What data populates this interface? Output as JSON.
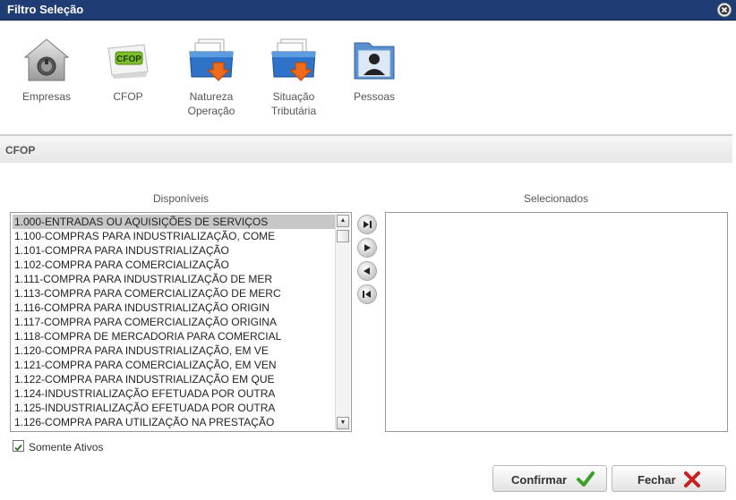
{
  "window": {
    "title": "Filtro Seleção"
  },
  "toolbar": {
    "items": [
      {
        "label": "Empresas",
        "icon": "lock-building-icon"
      },
      {
        "label": "CFOP",
        "icon": "cfop-icon"
      },
      {
        "label": "Natureza\nOperação",
        "icon": "folder-download-icon"
      },
      {
        "label": "Situação\nTributária",
        "icon": "folder-download-icon"
      },
      {
        "label": "Pessoas",
        "icon": "person-folder-icon"
      }
    ]
  },
  "section": {
    "title": "CFOP"
  },
  "available": {
    "header": "Disponíveis",
    "items": [
      "1.000-ENTRADAS OU AQUISIÇÕES DE SERVIÇOS",
      "1.100-COMPRAS PARA INDUSTRIALIZAÇÃO, COME",
      "1.101-COMPRA PARA INDUSTRIALIZAÇÃO",
      "1.102-COMPRA PARA COMERCIALIZAÇÃO",
      "1.111-COMPRA PARA INDUSTRIALIZAÇÃO DE MER",
      "1.113-COMPRA PARA COMERCIALIZAÇÃO DE MERC",
      "1.116-COMPRA PARA INDUSTRIALIZAÇÃO ORIGIN",
      "1.117-COMPRA PARA COMERCIALIZAÇÃO ORIGINA",
      "1.118-COMPRA DE MERCADORIA PARA COMERCIAL",
      "1.120-COMPRA PARA INDUSTRIALIZAÇÃO, EM VE",
      "1.121-COMPRA PARA COMERCIALIZAÇÃO, EM VEN",
      "1.122-COMPRA PARA INDUSTRIALIZAÇÃO EM QUE",
      "1.124-INDUSTRIALIZAÇÃO EFETUADA POR OUTRA",
      "1.125-INDUSTRIALIZAÇÃO EFETUADA POR OUTRA",
      "1.126-COMPRA PARA UTILIZAÇÃO NA PRESTAÇÃO"
    ]
  },
  "selected": {
    "header": "Selecionados",
    "items": []
  },
  "filter": {
    "label": "Somente Ativos",
    "checked": true
  },
  "buttons": {
    "confirm": "Confirmar",
    "close": "Fechar"
  },
  "colors": {
    "titlebar": "#1f3c73",
    "confirm_icon": "#3aa02a",
    "close_icon": "#c62020"
  }
}
